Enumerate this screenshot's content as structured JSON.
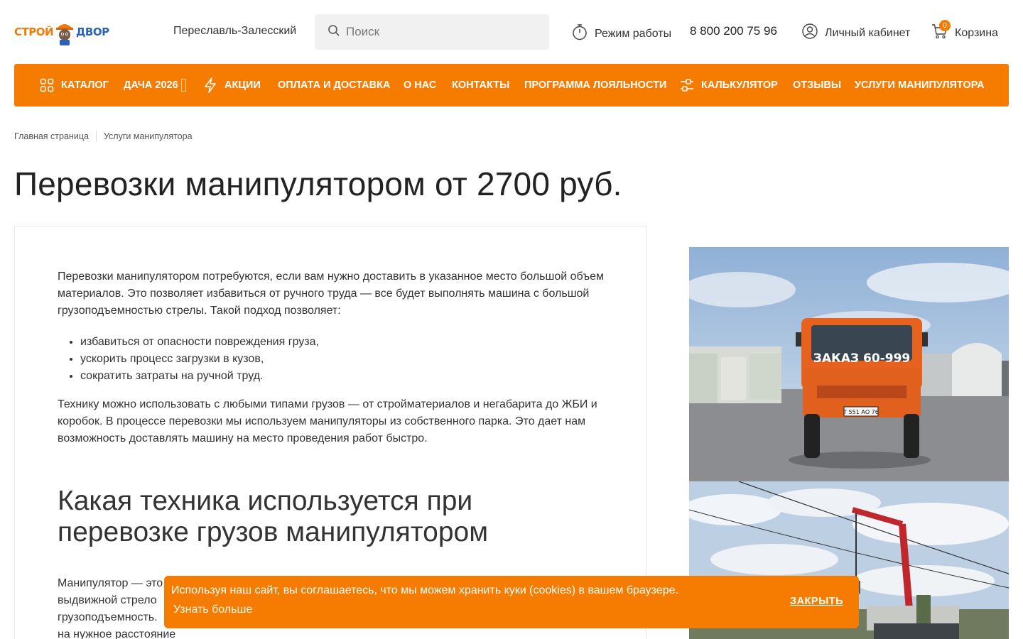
{
  "header": {
    "logo": {
      "part1": "СТРОЙ",
      "part2": "ДВОР"
    },
    "city": "Переславль-Залесский",
    "search_placeholder": "Поиск",
    "hours_label": "Режим работы",
    "phone": "8 800 200 75 96",
    "account_label": "Личный кабинет",
    "cart_label": "Корзина",
    "cart_count": "0"
  },
  "nav": {
    "items": [
      {
        "label": "КАТАЛОГ",
        "icon": "grid-icon"
      },
      {
        "label": "ДАЧА 2026",
        "icon": "missing-glyph"
      },
      {
        "label": "АКЦИИ",
        "icon": "lightning-icon"
      },
      {
        "label": "ОПЛАТА И ДОСТАВКА"
      },
      {
        "label": "О НАС"
      },
      {
        "label": "КОНТАКТЫ"
      },
      {
        "label": "ПРОГРАММА ЛОЯЛЬНОСТИ"
      },
      {
        "label": "КАЛЬКУЛЯТОР",
        "icon": "sliders-icon"
      },
      {
        "label": "ОТЗЫВЫ"
      },
      {
        "label": "УСЛУГИ МАНИПУЛЯТОРА"
      }
    ]
  },
  "breadcrumb": [
    "Главная страница",
    "Услуги манипулятора"
  ],
  "page_title": "Перевозки манипулятором от 2700 руб.",
  "content": {
    "intro": "Перевозки манипулятором потребуются, если вам нужно доставить в указанное место большой объем материалов. Это позволяет избавиться от ручного труда — все будет выполнять машина с большой грузоподъемностью стрелы. Такой подход позволяет:",
    "bullets": [
      "избавиться от опасности повреждения груза,",
      "ускорить процесс загрузки в кузов,",
      "сократить затраты на ручной труд."
    ],
    "para2": "Технику можно использовать с любыми типами грузов — от стройматериалов и негабарита до ЖБИ и коробок. В процессе перевозки мы используем манипуляторы из собственного парка. Это дает нам возможность доставлять машину на место проведения работ быстро.",
    "h2": "Какая техника используется при перевозке грузов манипулятором",
    "para3_lines": [
      "Манипулятор — это",
      "выдвижной стрело",
      "грузоподъемность.",
      "на нужное расстояние"
    ]
  },
  "photos": {
    "truck_sign": "ЗАКАЗ 60-999",
    "plate": "Т 551 АО 76"
  },
  "cookie": {
    "text": "Используя наш сайт, вы соглашаетесь, что мы можем хранить куки (cookies) в вашем браузере.",
    "link": "Узнать больше",
    "close": "ЗАКРЫТЬ"
  },
  "colors": {
    "accent": "#f57c00",
    "logo_blue": "#2a63b8"
  }
}
